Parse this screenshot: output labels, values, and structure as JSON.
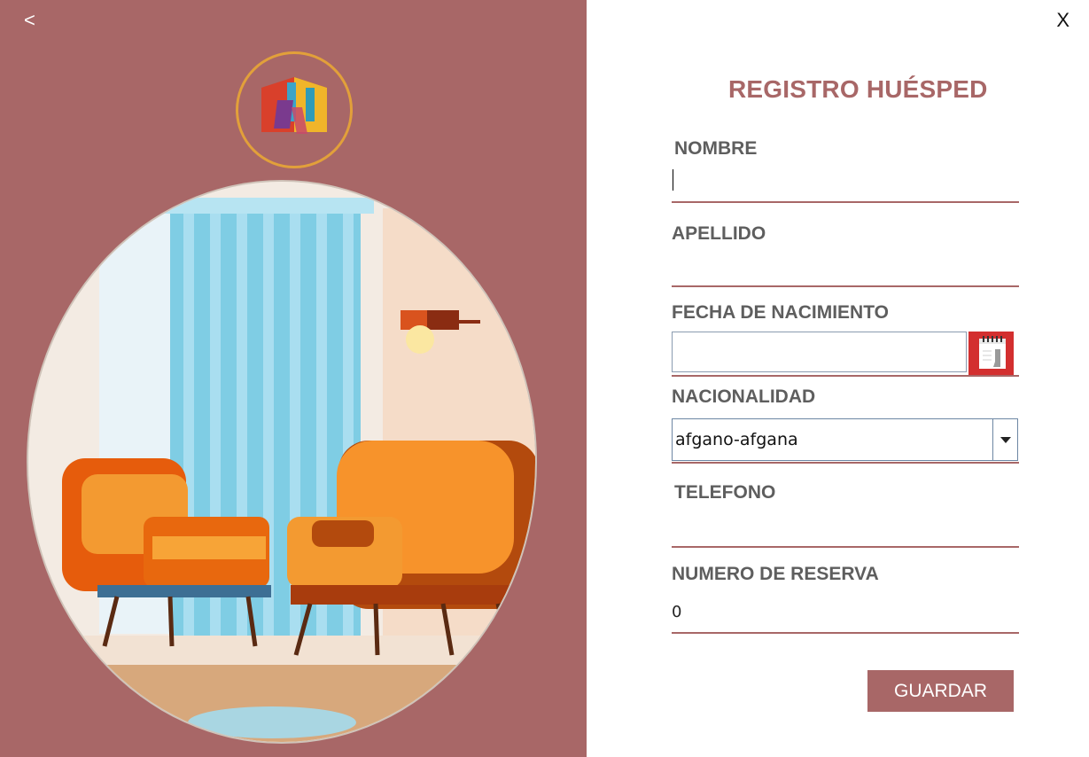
{
  "nav": {
    "back_label": "<",
    "close_label": "X"
  },
  "form": {
    "title": "REGISTRO HUÉSPED",
    "fields": {
      "nombre": {
        "label": "NOMBRE",
        "value": ""
      },
      "apellido": {
        "label": "APELLIDO",
        "value": ""
      },
      "fecha_nacimiento": {
        "label": "FECHA DE NACIMIENTO",
        "value": ""
      },
      "nacionalidad": {
        "label": "NACIONALIDAD",
        "selected": "afgano-afgana"
      },
      "telefono": {
        "label": "TELEFONO",
        "value": ""
      },
      "numero_reserva": {
        "label": "NUMERO DE RESERVA",
        "value": "0"
      }
    },
    "save_label": "GUARDAR"
  },
  "icons": {
    "logo": "hotel-logo-icon",
    "calendar": "calendar-icon",
    "dropdown": "chevron-down-icon"
  },
  "colors": {
    "accent": "#a86767",
    "logo_ring": "#e2a03a",
    "calendar_button": "#d32f2f"
  }
}
